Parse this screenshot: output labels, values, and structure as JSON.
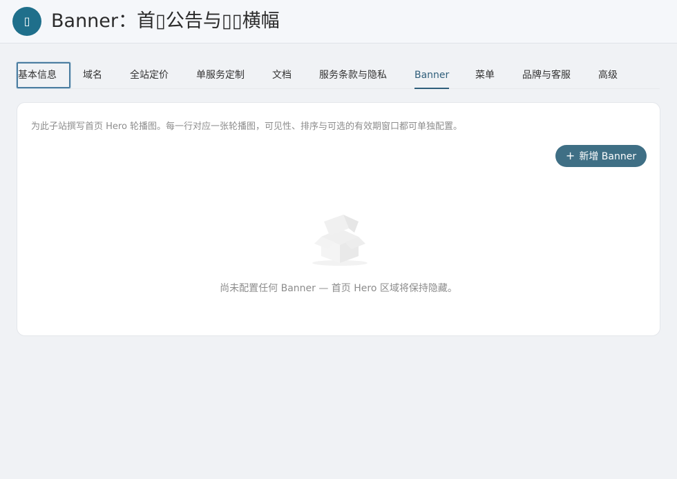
{
  "header": {
    "icon_glyph": "▯",
    "title": "Banner：首▯公告与▯▯横幅"
  },
  "tabs": [
    {
      "label": "基本信息"
    },
    {
      "label": "域名"
    },
    {
      "label": "全站定价"
    },
    {
      "label": "单服务定制"
    },
    {
      "label": "文档"
    },
    {
      "label": "服务条款与隐私"
    },
    {
      "label": "Banner"
    },
    {
      "label": "菜单"
    },
    {
      "label": "品牌与客服"
    },
    {
      "label": "高级"
    }
  ],
  "card": {
    "description": "为此子站撰写首页 Hero 轮播图。每一行对应一张轮播图，可见性、排序与可选的有效期窗口都可单独配置。",
    "add_button": {
      "icon": "+",
      "label": "新增 Banner"
    },
    "empty_text": "尚未配置任何 Banner — 首页 Hero 区域将保持隐藏。"
  }
}
